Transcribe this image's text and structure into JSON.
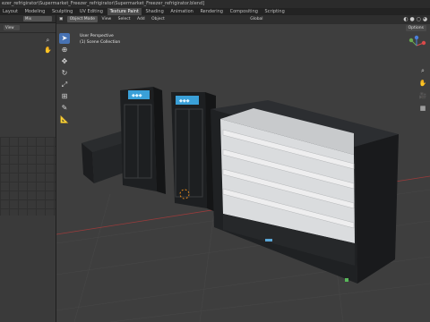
{
  "window": {
    "title": "ezer_refrigirator\\Supermarket_Freezer_refrigirator\\Supermarket_Freezer_refrigirator.blend]"
  },
  "menu": {
    "tabs": [
      "Layout",
      "Modeling",
      "Sculpting",
      "UV Editing",
      "Texture Paint",
      "Shading",
      "Animation",
      "Rendering",
      "Compositing",
      "Scripting"
    ],
    "active_tab": "Texture Paint"
  },
  "left_panel": {
    "image_name": "Mix",
    "view_field": "View"
  },
  "viewport_header": {
    "mode": "Object Mode",
    "menus": [
      "View",
      "Select",
      "Add",
      "Object"
    ],
    "orientation": "Global",
    "options_label": "Options"
  },
  "viewport_info": {
    "line1": "User Perspective",
    "line2": "(1) Scene Collection"
  },
  "colors": {
    "active_tab": "#4a4a4a",
    "active_tool": "#4772b3",
    "gizmo_x": "#d94a4a",
    "gizmo_y": "#6aa84f",
    "gizmo_z": "#4a7fd9",
    "logo_blue": "#6fd0ff"
  },
  "icons": {
    "tools": [
      "cursor-select-icon",
      "cursor-3d-icon",
      "move-icon",
      "rotate-icon",
      "scale-icon",
      "transform-icon",
      "annotate-icon",
      "measure-icon"
    ],
    "nav": [
      "zoom-icon",
      "pan-icon",
      "camera-icon",
      "grid-icon"
    ]
  }
}
